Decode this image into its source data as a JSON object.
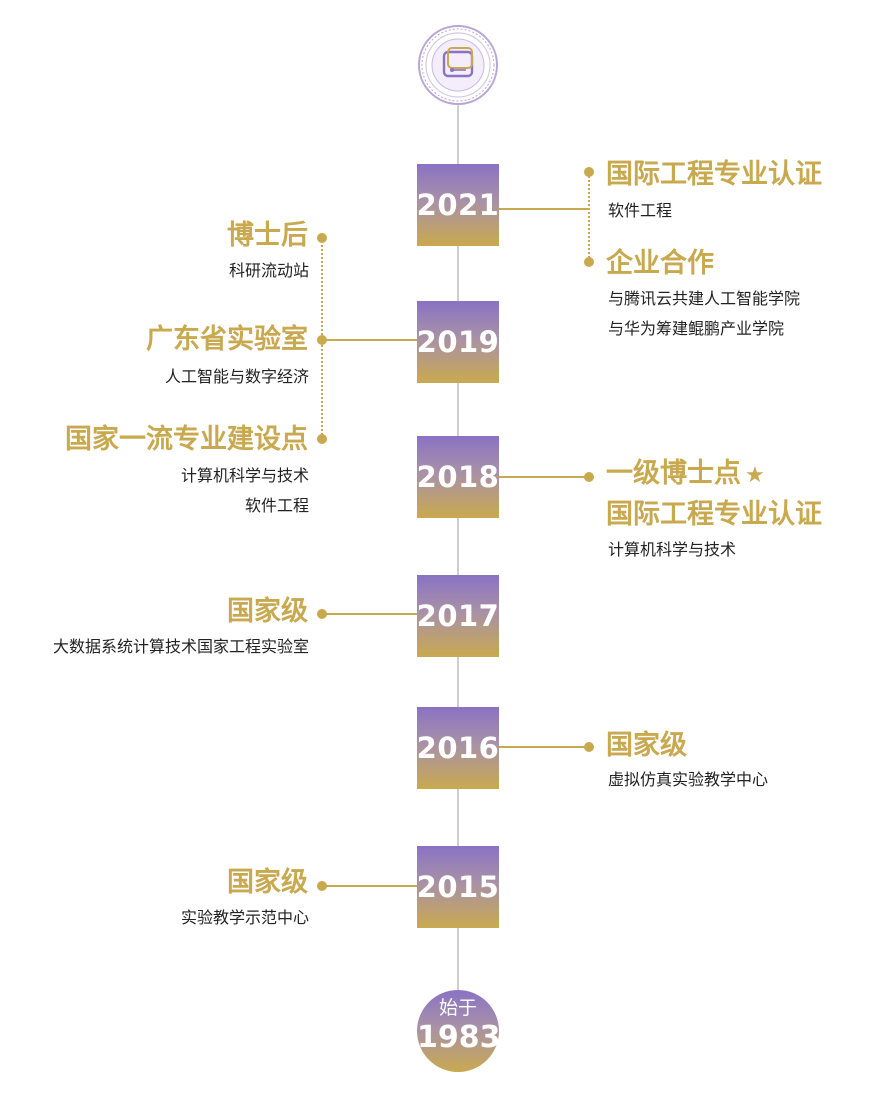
{
  "timeline": {
    "logo": "school-seal",
    "years": [
      "2021",
      "2019",
      "2018",
      "2017",
      "2016",
      "2015"
    ],
    "origin": {
      "label": "始于",
      "year": "1983"
    },
    "entries": {
      "y2021_a": {
        "title": "国际工程专业认证",
        "lines": [
          "软件工程"
        ]
      },
      "y2021_b": {
        "title": "企业合作",
        "lines": [
          "与腾讯云共建人工智能学院",
          "与华为筹建鲲鹏产业学院"
        ]
      },
      "y2019_a": {
        "title": "博士后",
        "lines": [
          "科研流动站"
        ]
      },
      "y2019_b": {
        "title": "广东省实验室",
        "lines": [
          "人工智能与数字经济"
        ]
      },
      "y2019_c": {
        "title": "国家一流专业建设点",
        "lines": [
          "计算机科学与技术",
          "软件工程"
        ]
      },
      "y2018": {
        "title1": "一级博士点",
        "star": "★",
        "title2": "国际工程专业认证",
        "lines": [
          "计算机科学与技术"
        ]
      },
      "y2017": {
        "title": "国家级",
        "lines": [
          "大数据系统计算技术国家工程实验室"
        ]
      },
      "y2016": {
        "title": "国家级",
        "lines": [
          "虚拟仿真实验教学中心"
        ]
      },
      "y2015": {
        "title": "国家级",
        "lines": [
          "实验教学示范中心"
        ]
      }
    },
    "colors": {
      "gold": "#c9a94f",
      "purple": "#8a72c4",
      "axis": "#cfcfcf",
      "text": "#222222"
    }
  }
}
